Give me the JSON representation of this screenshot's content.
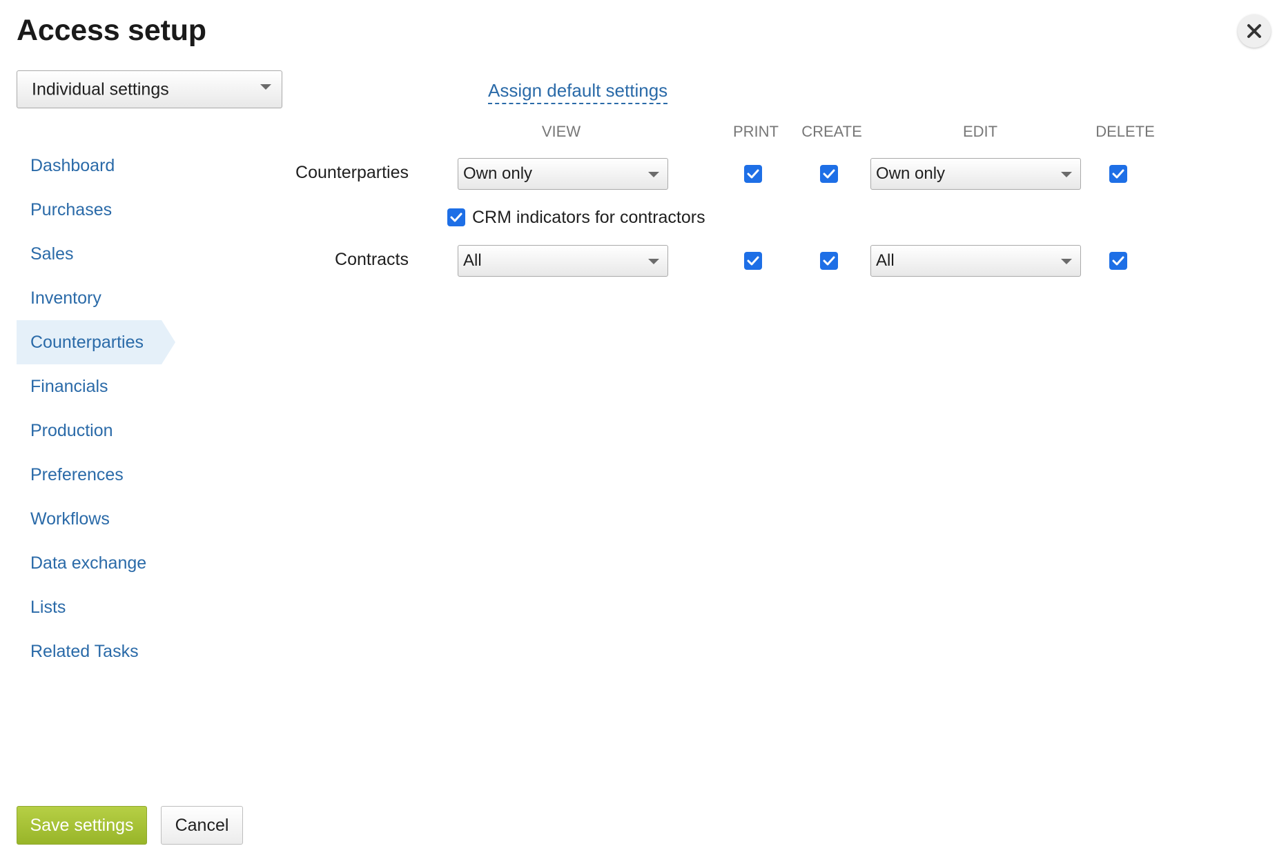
{
  "dialog": {
    "title": "Access setup",
    "close_icon": "close-icon"
  },
  "mode_select": {
    "value": "Individual settings"
  },
  "assign_default_link": "Assign default settings",
  "sidebar": {
    "active": "Counterparties",
    "items": [
      {
        "label": "Dashboard"
      },
      {
        "label": "Purchases"
      },
      {
        "label": "Sales"
      },
      {
        "label": "Inventory"
      },
      {
        "label": "Counterparties"
      },
      {
        "label": "Financials"
      },
      {
        "label": "Production"
      },
      {
        "label": "Preferences"
      },
      {
        "label": "Workflows"
      },
      {
        "label": "Data exchange"
      },
      {
        "label": "Lists"
      },
      {
        "label": "Related Tasks"
      }
    ]
  },
  "columns": {
    "view": "VIEW",
    "print": "PRINT",
    "create": "CREATE",
    "edit": "EDIT",
    "delete": "DELETE"
  },
  "rows": [
    {
      "label": "Counterparties",
      "view": "Own only",
      "print": true,
      "create": true,
      "edit": "Own only",
      "delete": true
    },
    {
      "label": "Contracts",
      "view": "All",
      "print": true,
      "create": true,
      "edit": "All",
      "delete": true
    }
  ],
  "crm_indicators": {
    "label": "CRM indicators for contractors",
    "checked": true
  },
  "footer": {
    "save_label": "Save settings",
    "cancel_label": "Cancel"
  },
  "colors": {
    "link": "#2a6aa8",
    "checkbox": "#1e6fe6",
    "save_button": "#a8c43a",
    "active_nav_bg": "#e5f0f9"
  }
}
